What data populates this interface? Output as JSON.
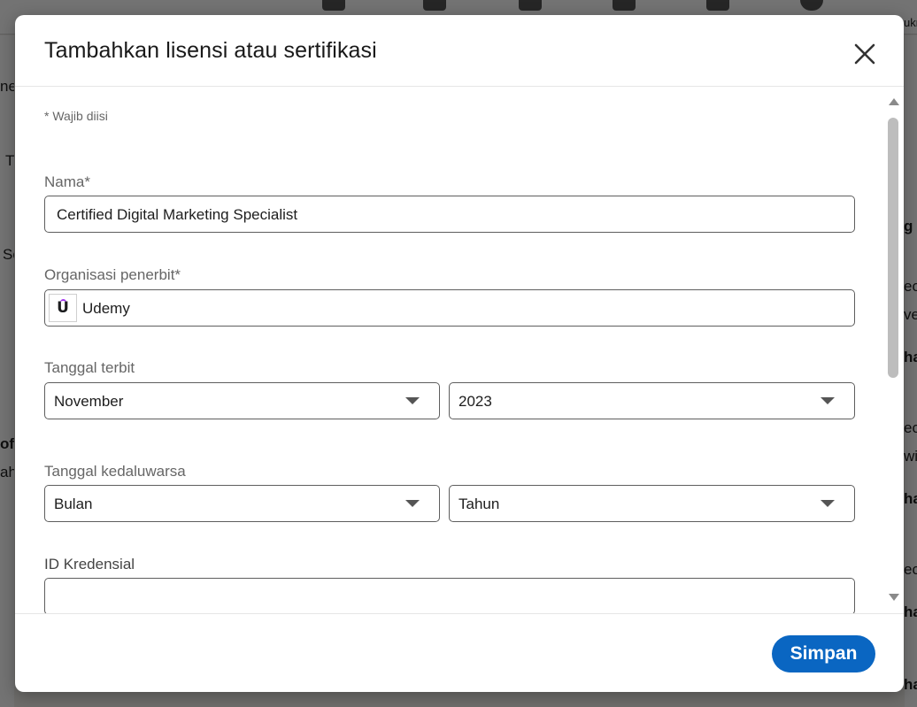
{
  "dialog": {
    "title": "Tambahkan lisensi atau sertifikasi",
    "required_note": "* Wajib diisi"
  },
  "form": {
    "name": {
      "label": "Nama*",
      "value": "Certified Digital Marketing Specialist"
    },
    "issuing_org": {
      "label": "Organisasi penerbit*",
      "value": "Udemy",
      "logo_letter": "U"
    },
    "issue_date": {
      "label": "Tanggal terbit",
      "month": "November",
      "year": "2023"
    },
    "expiration_date": {
      "label": "Tanggal kedaluwarsa",
      "month": "Bulan",
      "year": "Tahun"
    },
    "credential_id": {
      "label": "ID Kredensial",
      "value": ""
    }
  },
  "footer": {
    "save_label": "Simpan"
  },
  "background": {
    "snippets": [
      "ne",
      "T",
      "Sc",
      "ofi",
      "ah",
      "ukn",
      "g A",
      "ec",
      "ve",
      "ha",
      "ec",
      "wi",
      "ha",
      "ec",
      "ha",
      "ha"
    ]
  },
  "colors": {
    "primary": "#0a66c2",
    "udemy_accent": "#a435f0",
    "border": "#5e5e5e"
  },
  "icons": {
    "close": "close-icon",
    "dropdown": "chevron-down-icon"
  }
}
